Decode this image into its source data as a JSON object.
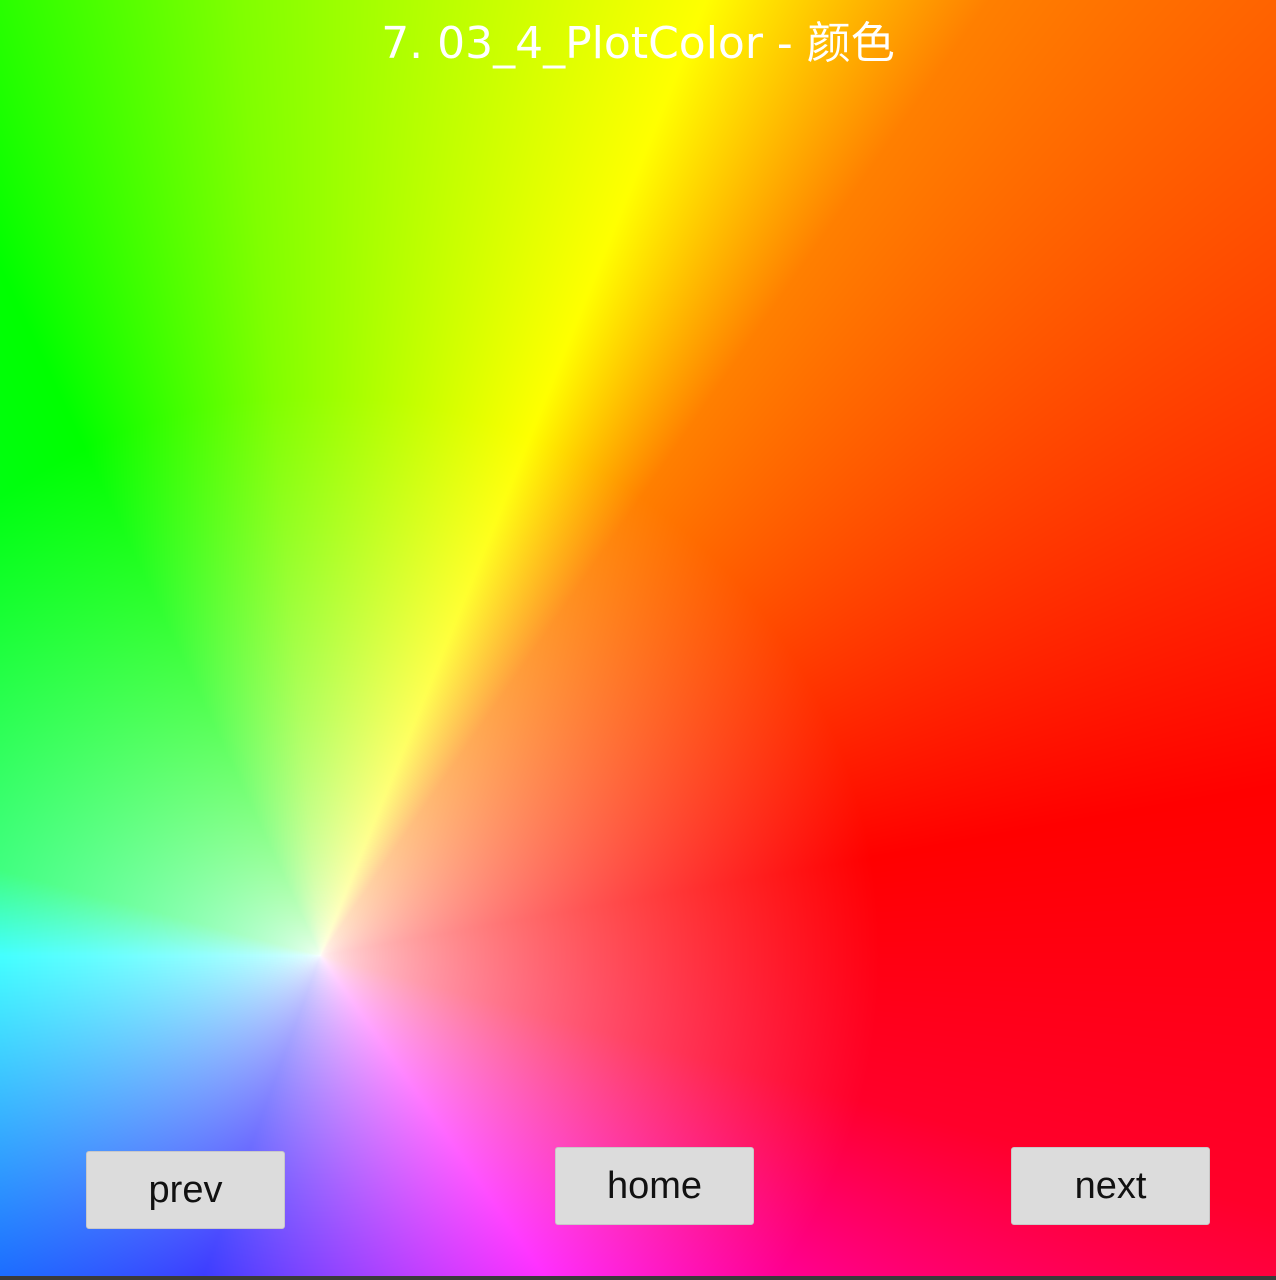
{
  "page": {
    "title": "7.  03_4_PlotColor - 颜色"
  },
  "canvas": {
    "description_colors": {
      "green": "#00ff00",
      "yellow": "#ffff00",
      "red": "#ff0000",
      "cyan": "#00ffff",
      "blue": "#0000ff",
      "magenta": "#ff00ff",
      "white": "#ffffff"
    }
  },
  "nav": {
    "prev_label": "prev",
    "home_label": "home",
    "next_label": "next"
  }
}
